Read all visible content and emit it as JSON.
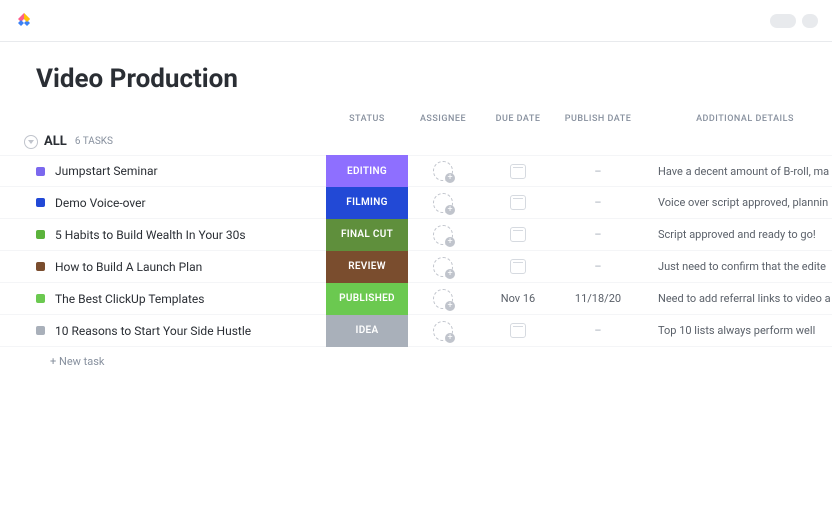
{
  "header": {
    "title": "Video Production"
  },
  "columns": {
    "status": "STATUS",
    "assignee": "ASSIGNEE",
    "due": "DUE DATE",
    "publish": "PUBLISH DATE",
    "details": "ADDITIONAL DETAILS"
  },
  "group": {
    "name": "ALL",
    "count": "6 TASKS"
  },
  "tasks": [
    {
      "color": "#7b68ee",
      "title": "Jumpstart Seminar",
      "status": "EDITING",
      "status_color": "#8e6fff",
      "due": "",
      "publish": "–",
      "details": "Have a decent amount of B-roll, ma"
    },
    {
      "color": "#2249d6",
      "title": "Demo Voice-over",
      "status": "FILMING",
      "status_color": "#2249d6",
      "due": "",
      "publish": "–",
      "details": "Voice over script approved, plannin"
    },
    {
      "color": "#5bb33c",
      "title": "5 Habits to Build Wealth In Your 30s",
      "status": "FINAL CUT",
      "status_color": "#5f8f3c",
      "due": "",
      "publish": "–",
      "details": "Script approved and ready to go!"
    },
    {
      "color": "#7a4d2e",
      "title": "How to Build A Launch Plan",
      "status": "REVIEW",
      "status_color": "#7a4d2e",
      "due": "",
      "publish": "–",
      "details": "Just need to confirm that the edite"
    },
    {
      "color": "#6bc950",
      "title": "The Best ClickUp Templates",
      "status": "PUBLISHED",
      "status_color": "#6bc950",
      "due": "Nov 16",
      "publish": "11/18/20",
      "details": "Need to add referral links to video a"
    },
    {
      "color": "#a9b0ba",
      "title": "10 Reasons to Start Your Side Hustle",
      "status": "IDEA",
      "status_color": "#a9b0ba",
      "due": "",
      "publish": "–",
      "details": "Top 10 lists always perform well"
    }
  ],
  "new_task": "+ New task"
}
